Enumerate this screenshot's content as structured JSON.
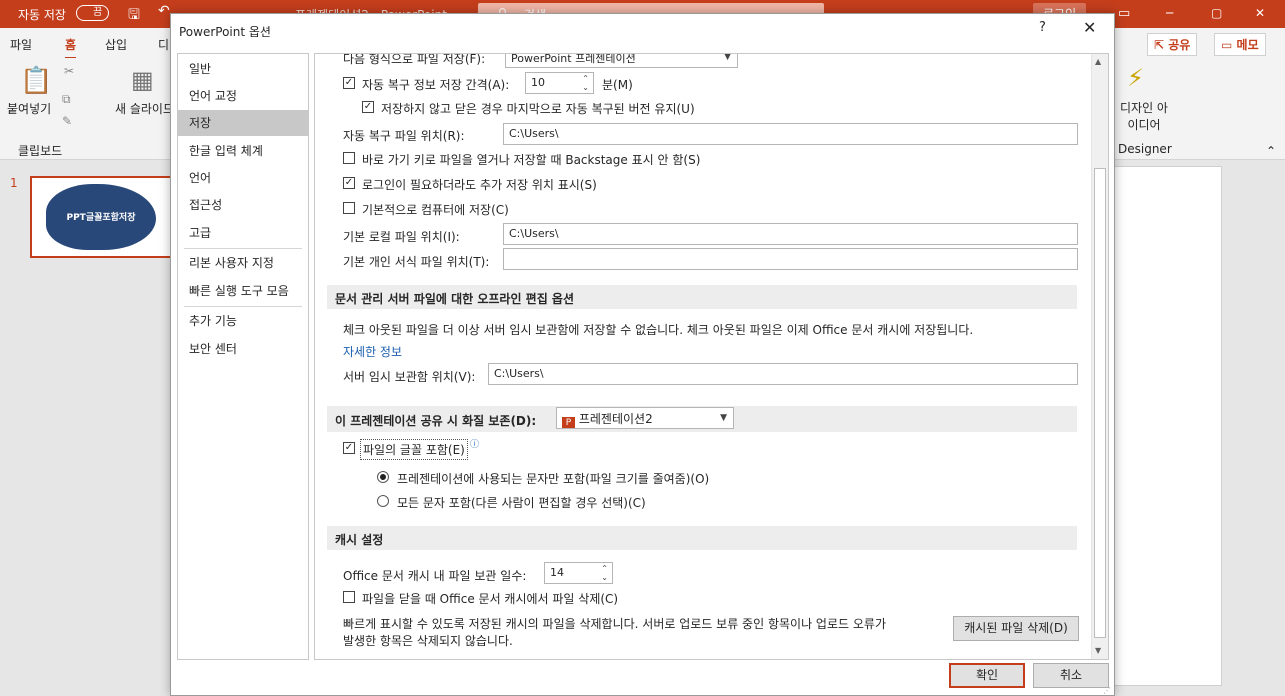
{
  "app": {
    "autosave_label": "자동 저장",
    "autosave_state": "끔",
    "doc_title": "프레젠테이션2 - PowerPoint",
    "search_placeholder": "검색",
    "login": "로그인",
    "tabs": [
      "파일",
      "홈",
      "삽입",
      "디"
    ],
    "share": "공유",
    "memo": "메모",
    "paste": "붙여넣기",
    "new_slide": "새 슬라이드",
    "clipboard": "클립보드",
    "design_ideas": "디자인 아이디어",
    "designer": "Designer",
    "slide_number": "1",
    "slide_text": "PPT글꼴포함저장",
    "accent": "#c43e1c"
  },
  "dialog": {
    "title": "PowerPoint 옵션",
    "help": "?",
    "close": "✕",
    "nav": [
      "일반",
      "언어 교정",
      "저장",
      "한글 입력 체계",
      "언어",
      "접근성",
      "고급",
      "리본 사용자 지정",
      "빠른 실행 도구 모음",
      "추가 기능",
      "보안 센터"
    ],
    "selected_nav": "저장",
    "save": {
      "format_label": "다음 형식으로 파일 저장(F):",
      "format_value": "PowerPoint 프레젠테이션",
      "autorecover_label": "자동 복구 정보 저장 간격(A):",
      "autorecover_value": "10",
      "minutes": "분(M)",
      "keep_last": "저장하지 않고 닫은 경우 마지막으로 자동 복구된 버전 유지(U)",
      "autorecover_location_label": "자동 복구 파일 위치(R):",
      "autorecover_location": "C:\\Users\\",
      "no_backstage": "바로 가기 키로 파일을 열거나 저장할 때 Backstage 표시 안 함(S)",
      "show_additional": "로그인이 필요하더라도 추가 저장 위치 표시(S)",
      "save_to_computer": "기본적으로 컴퓨터에 저장(C)",
      "local_location_label": "기본 로컬 파일 위치(I):",
      "local_location": "C:\\Users\\",
      "template_location_label": "기본 개인 서식 파일 위치(T):",
      "template_location": ""
    },
    "offline": {
      "header": "문서 관리 서버 파일에 대한 오프라인 편집 옵션",
      "desc": "체크 아웃된 파일을 더 이상 서버 임시 보관함에 저장할 수 없습니다. 체크 아웃된 파일은 이제 Office 문서 캐시에 저장됩니다.",
      "more_info": "자세한 정보",
      "drafts_label": "서버 임시 보관함 위치(V):",
      "drafts_location": "C:\\Users\\"
    },
    "fidelity": {
      "header": "이 프레젠테이션 공유 시 화질 보존(D):",
      "presentation": "프레젠테이션2",
      "embed_fonts": "파일의 글꼴 포함(E)",
      "embed_used_only": "프레젠테이션에 사용되는 문자만 포함(파일 크기를 줄여줌)(O)",
      "embed_all": "모든 문자 포함(다른 사람이 편집할 경우 선택)(C)"
    },
    "cache": {
      "header": "캐시 설정",
      "days_label": "Office 문서 캐시 내 파일 보관 일수:",
      "days_value": "14",
      "delete_on_close": "파일을 닫을 때 Office 문서 캐시에서 파일 삭제(C)",
      "desc_line1": "빠르게 표시할 수 있도록 저장된 캐시의 파일을 삭제합니다. 서버로 업로드 보류 중인 항목이나 업로드 오류가",
      "desc_line2": "발생한 항목은 삭제되지 않습니다.",
      "delete_button": "캐시된 파일 삭제(D)"
    },
    "ok": "확인",
    "cancel": "취소"
  }
}
